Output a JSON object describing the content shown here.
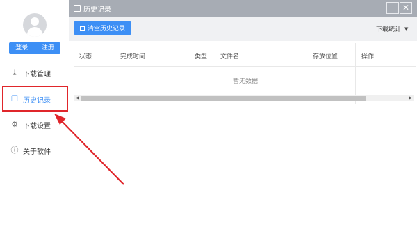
{
  "sidebar": {
    "auth": {
      "login": "登录",
      "register": "注册"
    },
    "items": [
      {
        "label": "下载管理",
        "icon": "download-icon"
      },
      {
        "label": "历史记录",
        "icon": "history-icon",
        "active": true
      },
      {
        "label": "下载设置",
        "icon": "gear-icon"
      },
      {
        "label": "关于软件",
        "icon": "info-icon"
      }
    ]
  },
  "window": {
    "title": "历史记录",
    "minimize": "—",
    "close": "✕"
  },
  "toolbar": {
    "clear_label": "清空历史记录",
    "stats_label": "下载统计"
  },
  "table": {
    "columns": [
      "状态",
      "完成时间",
      "类型",
      "文件名",
      "存放位置",
      "操作"
    ],
    "empty_text": "暂无数据"
  },
  "colors": {
    "accent": "#3d8ff5",
    "titlebar": "#a7acb4",
    "highlight": "#e0262b"
  }
}
